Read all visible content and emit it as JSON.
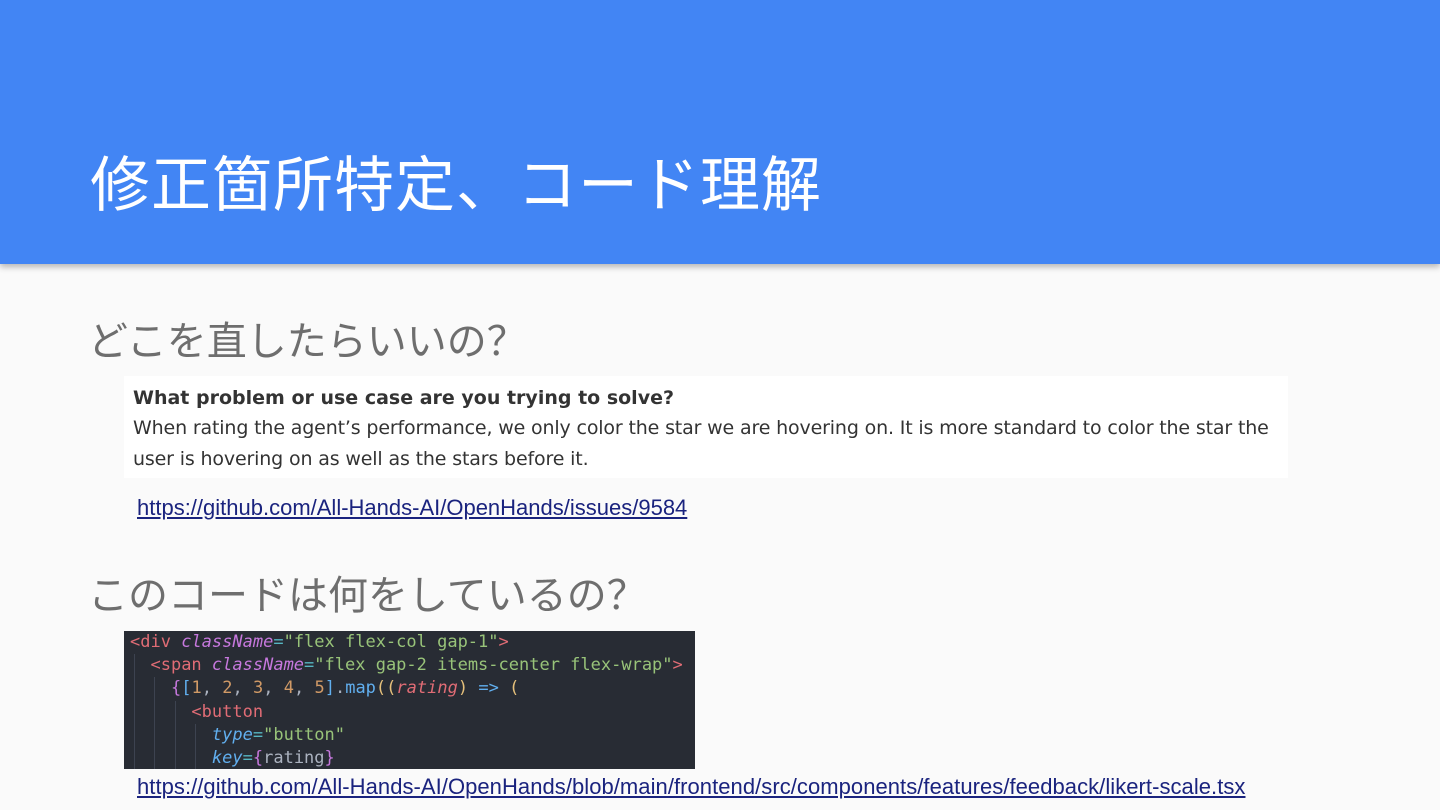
{
  "slide": {
    "title": "修正箇所特定、コード理解",
    "sections": [
      {
        "heading": "どこを直したらいいの？",
        "issue": {
          "question": "What problem or use case are you trying to solve?",
          "answer_line1": "When rating the agent’s performance, we only color the star we are hovering on. It is more standard to color the star the",
          "answer_line2": "user is hovering on as well as the stars before it."
        },
        "link": "https://github.com/All-Hands-AI/OpenHands/issues/9584"
      },
      {
        "heading": "このコードは何をしているの？",
        "code_lines": [
          "<div className=\"flex flex-col gap-1\">",
          "  <span className=\"flex gap-2 items-center flex-wrap\">",
          "    {[1, 2, 3, 4, 5].map((rating) => (",
          "      <button",
          "        type=\"button\"",
          "        key={rating}"
        ],
        "link": "https://github.com/All-Hands-AI/OpenHands/blob/main/frontend/src/components/features/feedback/likert-scale.tsx"
      }
    ]
  },
  "colors": {
    "header_bg": "#4285f4",
    "slide_bg": "#fafafa",
    "heading_text": "#6e6e6e",
    "link": "#1a237e",
    "code_bg": "#282c34"
  }
}
